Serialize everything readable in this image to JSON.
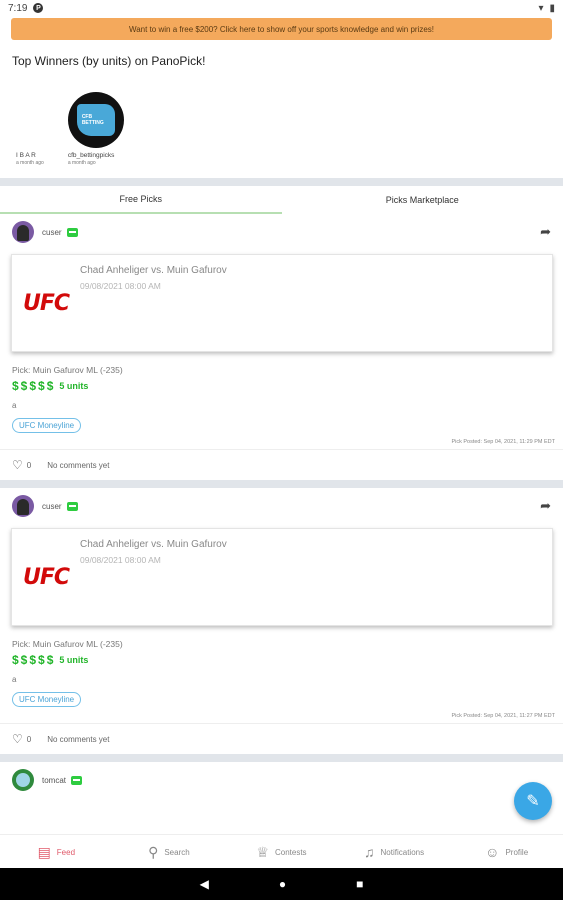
{
  "status_bar": {
    "time": "7:19",
    "app_glyph": "P"
  },
  "banner": {
    "text": "Want to win a free $200? Click here to show off your sports knowledge and win prizes!"
  },
  "winners": {
    "title": "Top Winners (by units) on PanoPick!",
    "items": [
      {
        "name": "I B A R",
        "ago": "a month ago",
        "has_avatar": false
      },
      {
        "name": "cfb_bettingpicks",
        "ago": "a month ago",
        "has_avatar": true,
        "avatar_text": "CFB BETTING"
      }
    ]
  },
  "tabs": [
    {
      "label": "Free Picks",
      "active": true
    },
    {
      "label": "Picks Marketplace",
      "active": false
    }
  ],
  "posts": [
    {
      "user": "cuser",
      "card_logo": "UFC",
      "card_title": "Chad Anheliger vs. Muin Gafurov",
      "card_date": "09/08/2021 08:00 AM",
      "pick": "Pick: Muin Gafurov ML (-235)",
      "dollars": "$$$$$",
      "units": "5 units",
      "note": "a",
      "tag": "UFC Moneyline",
      "posted": "Pick Posted: Sep 04, 2021, 11:29 PM EDT",
      "likes": "0",
      "comments": "No comments yet"
    },
    {
      "user": "cuser",
      "card_logo": "UFC",
      "card_title": "Chad Anheliger vs. Muin Gafurov",
      "card_date": "09/08/2021 08:00 AM",
      "pick": "Pick: Muin Gafurov ML (-235)",
      "dollars": "$$$$$",
      "units": "5 units",
      "note": "a",
      "tag": "UFC Moneyline",
      "posted": "Pick Posted: Sep 04, 2021, 11:27 PM EDT",
      "likes": "0",
      "comments": "No comments yet"
    }
  ],
  "third_post": {
    "user": "tomcat"
  },
  "bottom_nav": [
    {
      "label": "Feed",
      "icon": "feed-icon",
      "active": true
    },
    {
      "label": "Search",
      "icon": "search-icon",
      "active": false
    },
    {
      "label": "Contests",
      "icon": "trophy-icon",
      "active": false
    },
    {
      "label": "Notifications",
      "icon": "bell-icon",
      "active": false
    },
    {
      "label": "Profile",
      "icon": "profile-icon",
      "active": false
    }
  ],
  "colors": {
    "banner": "#f4a95c",
    "units_green": "#22b52a",
    "fab": "#3aa7e6",
    "nav_active": "#e05a6a",
    "ufc_red": "#d20a0a"
  }
}
